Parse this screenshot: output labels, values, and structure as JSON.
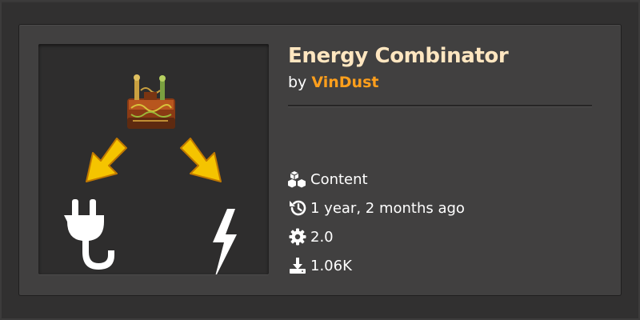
{
  "mod": {
    "title": "Energy Combinator",
    "by_prefix": "by",
    "author": "VinDust"
  },
  "meta": {
    "category": "Content",
    "updated": "1 year, 2 months ago",
    "version": "2.0",
    "downloads": "1.06K"
  },
  "icons": {
    "thumbnail": "energy-combinator-thumbnail",
    "category": "cubes-icon",
    "updated": "history-icon",
    "version": "gear-icon",
    "downloads": "download-icon"
  },
  "colors": {
    "title": "#ffe6c0",
    "author": "#ff9f1c",
    "card": "#414040",
    "background": "#313030"
  }
}
